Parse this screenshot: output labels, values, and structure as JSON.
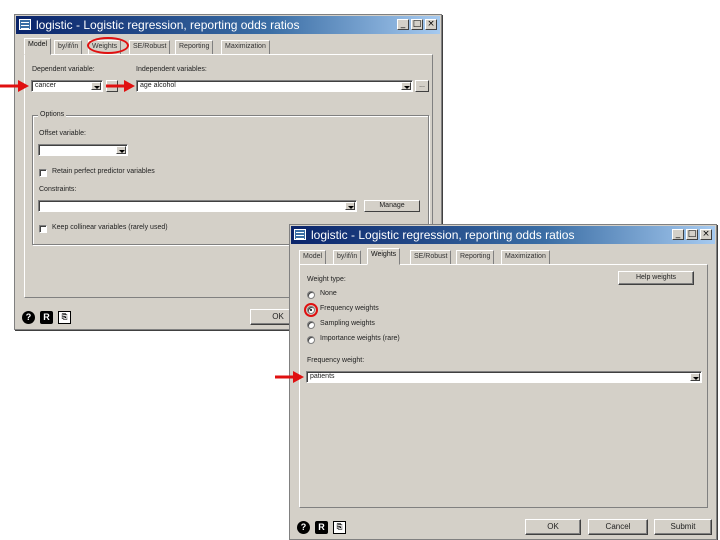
{
  "colors": {
    "title_start": "#0a246a",
    "title_end": "#a6caf0",
    "dialog_bg": "#d4d0c8",
    "annotation": "#e01010"
  },
  "back_dialog": {
    "title": "logistic - Logistic regression, reporting odds ratios",
    "title_buttons": [
      "_",
      "□",
      "×"
    ],
    "tabs": [
      "Model",
      "by/if/in",
      "Weights",
      "SE/Robust",
      "Reporting",
      "Maximization"
    ],
    "dependent_label": "Dependent variable:",
    "dependent_value": "cancer",
    "independent_label": "Independent variables:",
    "independent_value": "age alcohol",
    "browse_label": "...",
    "options_legend": "Options",
    "offset_label": "Offset variable:",
    "offset_value": "",
    "retain_label": "Retain perfect predictor variables",
    "constraints_label": "Constraints:",
    "constraints_value": "",
    "manage_label": "Manage",
    "keep_collinear_label": "Keep collinear variables (rarely used)",
    "ok_label": "OK",
    "help_icon": "?",
    "r_icon": "R",
    "copy_icon": "⎘"
  },
  "front_dialog": {
    "title": "logistic - Logistic regression, reporting odds ratios",
    "title_buttons": [
      "_",
      "□",
      "×"
    ],
    "tabs": [
      "Model",
      "by/if/in",
      "Weights",
      "SE/Robust",
      "Reporting",
      "Maximization"
    ],
    "weight_type_label": "Weight type:",
    "help_weights_label": "Help weights",
    "radio_options": [
      {
        "label": "None",
        "selected": false
      },
      {
        "label": "Frequency weights",
        "selected": true
      },
      {
        "label": "Sampling weights",
        "selected": false
      },
      {
        "label": "Importance weights (rare)",
        "selected": false
      }
    ],
    "freq_weight_label": "Frequency weight:",
    "freq_weight_value": "patients",
    "ok_label": "OK",
    "cancel_label": "Cancel",
    "submit_label": "Submit",
    "help_icon": "?",
    "r_icon": "R",
    "copy_icon": "⎘"
  }
}
